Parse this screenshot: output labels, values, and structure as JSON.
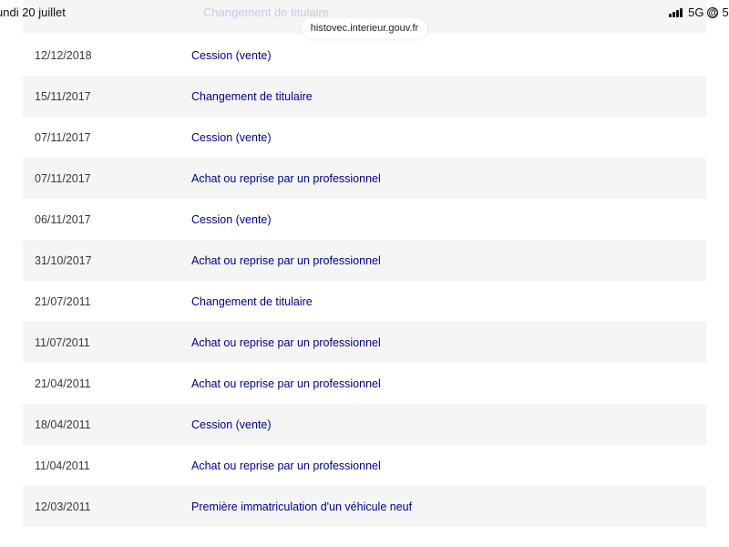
{
  "status_bar": {
    "date": "undi 20 juillet",
    "network": "5G",
    "battery_partial": "5("
  },
  "browser": {
    "url": "histovec.interieur.gouv.fr"
  },
  "history": {
    "cut_off_event": "Changement de titulaire",
    "rows": [
      {
        "date": "12/12/2018",
        "event": "Cession (vente)"
      },
      {
        "date": "15/11/2017",
        "event": "Changement de titulaire"
      },
      {
        "date": "07/11/2017",
        "event": "Cession (vente)"
      },
      {
        "date": "07/11/2017",
        "event": "Achat ou reprise par un professionnel"
      },
      {
        "date": "06/11/2017",
        "event": "Cession (vente)"
      },
      {
        "date": "31/10/2017",
        "event": "Achat ou reprise par un professionnel"
      },
      {
        "date": "21/07/2011",
        "event": "Changement de titulaire"
      },
      {
        "date": "11/07/2011",
        "event": "Achat ou reprise par un professionnel"
      },
      {
        "date": "21/04/2011",
        "event": "Achat ou reprise par un professionnel"
      },
      {
        "date": "18/04/2011",
        "event": "Cession (vente)"
      },
      {
        "date": "11/04/2011",
        "event": "Achat ou reprise par un professionnel"
      },
      {
        "date": "12/03/2011",
        "event": "Première immatriculation d'un véhicule neuf"
      }
    ]
  },
  "colors": {
    "event_link": "#000091",
    "row_shade": "#f5f5f5",
    "date_text": "#3a3a3a"
  }
}
